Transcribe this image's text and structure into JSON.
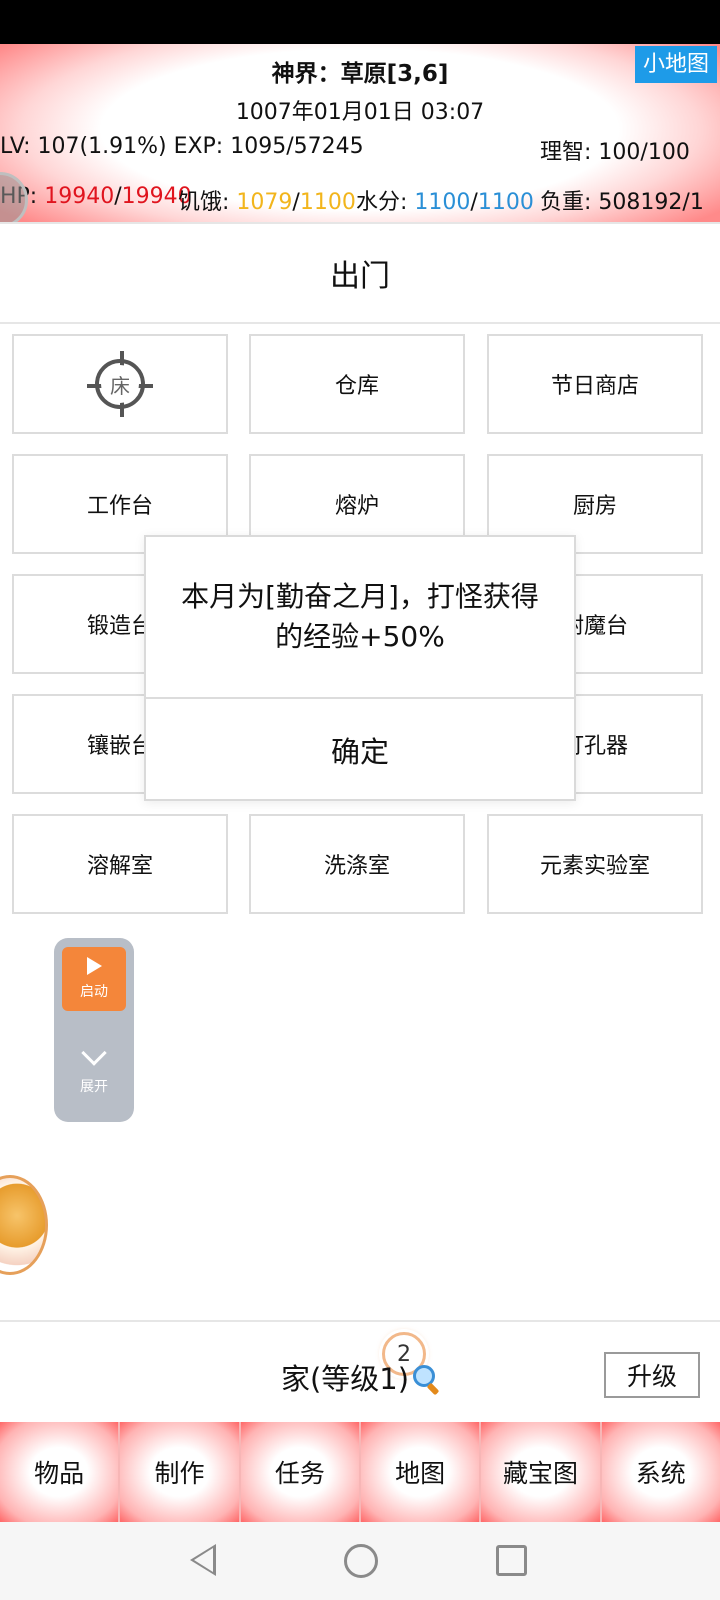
{
  "header": {
    "location": "神界：草原[3,6]",
    "datetime": "1007年01月01日 03:07",
    "minimap_label": "小地图",
    "lv_label": "LV:",
    "lv_value": "107(1.91%)",
    "exp_label": "EXP:",
    "exp_value": "1095/57245",
    "sanity_label": "理智:",
    "sanity_value": "100/100",
    "hp_label": "HP:",
    "hp_current": "19940",
    "hp_max": "19940",
    "hunger_label": "饥饿:",
    "hunger_current": "1079",
    "hunger_max": "1100",
    "water_label": "水分:",
    "water_current": "1100",
    "water_max": "1100",
    "weight_label": "负重:",
    "weight_value": "508192/1",
    "slash": "/"
  },
  "page_title": "出门",
  "grid": {
    "bed_label": "床",
    "warehouse": "仓库",
    "holiday_shop": "节日商店",
    "workbench": "工作台",
    "furnace": "熔炉",
    "kitchen": "厨房",
    "forge": "锻造台",
    "enchant": "附魔台",
    "inlay": "镶嵌台",
    "punch": "打孔器",
    "dissolve": "溶解室",
    "wash": "洗涤室",
    "element_lab": "元素实验室"
  },
  "dialog": {
    "message": "本月为[勤奋之月]，打怪获得的经验+50%",
    "confirm": "确定"
  },
  "float_panel": {
    "start_label": "启动",
    "expand_label": "展开"
  },
  "home": {
    "title": "家(等级1)",
    "badge_count": "2",
    "upgrade_label": "升级"
  },
  "tabs": [
    "物品",
    "制作",
    "任务",
    "地图",
    "藏宝图",
    "系统"
  ]
}
